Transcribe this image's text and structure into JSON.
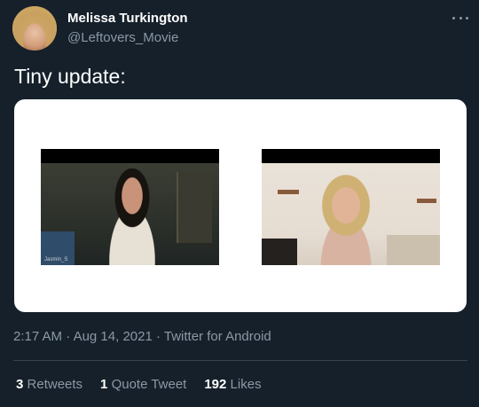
{
  "author": {
    "name": "Melissa Turkington",
    "handle": "@Leftovers_Movie"
  },
  "tweet": {
    "text": "Tiny update:"
  },
  "media": {
    "left_tag": "Jasmin_S"
  },
  "meta": {
    "time": "2:17 AM",
    "separator1": "·",
    "date": "Aug 14, 2021",
    "separator2": "·",
    "source": "Twitter for Android"
  },
  "stats": {
    "retweets_count": "3",
    "retweets_label": "Retweets",
    "quotes_count": "1",
    "quotes_label": "Quote Tweet",
    "likes_count": "192",
    "likes_label": "Likes"
  },
  "colors": {
    "background": "#15202b",
    "secondary_text": "#8b98a5",
    "divider": "#38444d"
  },
  "icons": {
    "more": "more-horizontal-icon"
  }
}
